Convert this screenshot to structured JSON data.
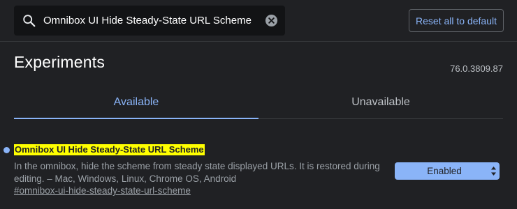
{
  "search": {
    "value": "Omnibox UI Hide Steady-State URL Scheme",
    "icon": "search-icon",
    "clear_icon": "clear-icon"
  },
  "header": {
    "reset_label": "Reset all to default"
  },
  "page": {
    "title": "Experiments",
    "version": "76.0.3809.87"
  },
  "tabs": [
    {
      "label": "Available",
      "active": true
    },
    {
      "label": "Unavailable",
      "active": false
    }
  ],
  "experiment": {
    "title": "Omnibox UI Hide Steady-State URL Scheme",
    "description": "In the omnibox, hide the scheme from steady state displayed URLs. It is restored during editing. – Mac, Windows, Linux, Chrome OS, Android",
    "link": "#omnibox-ui-hide-steady-state-url-scheme",
    "state": "Enabled",
    "highlight_color": "#ffff00"
  },
  "colors": {
    "background": "#202124",
    "accent": "#8ab4f8",
    "search_bg": "#121315"
  }
}
